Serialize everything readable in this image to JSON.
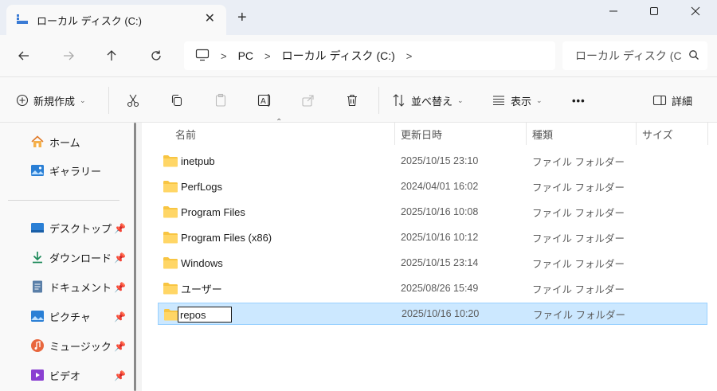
{
  "window": {
    "tab_title": "ローカル ディスク (C:)",
    "close_tab": "✕",
    "new_tab": "+"
  },
  "address": {
    "crumbs": [
      "PC",
      "ローカル ディスク (C:)"
    ],
    "search_placeholder": "ローカル ディスク (C"
  },
  "toolbar": {
    "new_label": "新規作成",
    "sort_label": "並べ替え",
    "view_label": "表示",
    "more_label": "•••",
    "details_label": "詳細"
  },
  "sidebar": {
    "items": [
      {
        "label": "ホーム",
        "icon": "home-icon"
      },
      {
        "label": "ギャラリー",
        "icon": "gallery-icon"
      }
    ],
    "pinned": [
      {
        "label": "デスクトップ",
        "icon": "desktop-icon"
      },
      {
        "label": "ダウンロード",
        "icon": "download-icon"
      },
      {
        "label": "ドキュメント",
        "icon": "document-icon"
      },
      {
        "label": "ピクチャ",
        "icon": "pictures-icon"
      },
      {
        "label": "ミュージック",
        "icon": "music-icon"
      },
      {
        "label": "ビデオ",
        "icon": "video-icon"
      }
    ]
  },
  "columns": {
    "name": "名前",
    "date": "更新日時",
    "type": "種類",
    "size": "サイズ"
  },
  "files": [
    {
      "name": "inetpub",
      "date": "2025/10/15 23:10",
      "type": "ファイル フォルダー"
    },
    {
      "name": "PerfLogs",
      "date": "2024/04/01 16:02",
      "type": "ファイル フォルダー"
    },
    {
      "name": "Program Files",
      "date": "2025/10/16 10:08",
      "type": "ファイル フォルダー"
    },
    {
      "name": "Program Files (x86)",
      "date": "2025/10/16 10:12",
      "type": "ファイル フォルダー"
    },
    {
      "name": "Windows",
      "date": "2025/10/15 23:14",
      "type": "ファイル フォルダー"
    },
    {
      "name": "ユーザー",
      "date": "2025/08/26 15:49",
      "type": "ファイル フォルダー"
    },
    {
      "name": "repos",
      "date": "2025/10/16 10:20",
      "type": "ファイル フォルダー",
      "renaming": true
    }
  ],
  "colors": {
    "selected_bg": "#cce8ff",
    "folder": "#f8c542"
  }
}
